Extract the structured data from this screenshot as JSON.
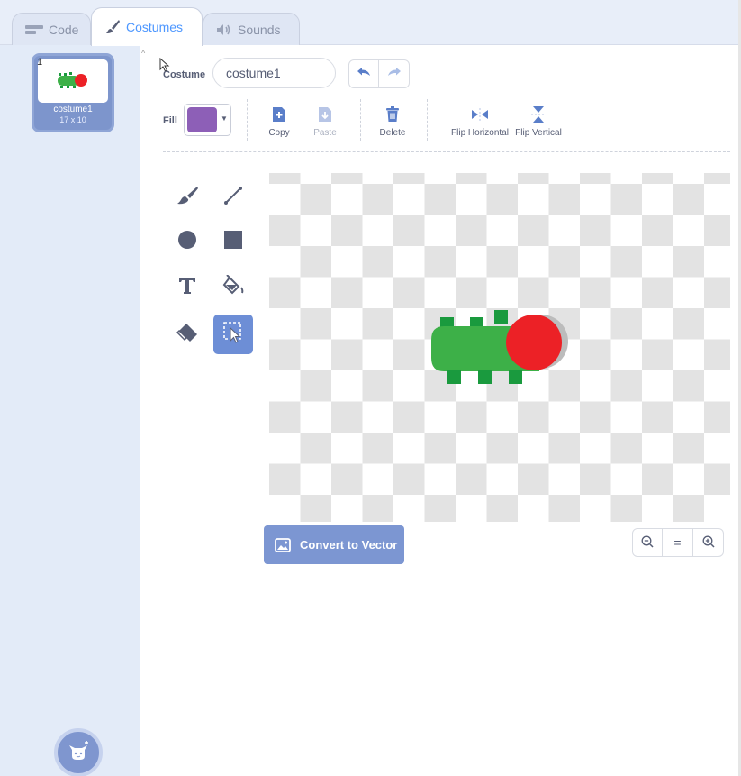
{
  "tabs": {
    "code": "Code",
    "costumes": "Costumes",
    "sounds": "Sounds"
  },
  "costume_list": {
    "items": [
      {
        "number": "1",
        "name": "costume1",
        "size": "17 x 10"
      }
    ]
  },
  "editor": {
    "costume_label": "Costume",
    "costume_name": "costume1",
    "fill_label": "Fill",
    "fill_color": "#8d5fb7",
    "actions": {
      "copy": "Copy",
      "paste": "Paste",
      "delete": "Delete",
      "flip_horizontal": "Flip Horizontal",
      "flip_vertical": "Flip Vertical"
    },
    "convert_button": "Convert to Vector",
    "zoom": {
      "reset": "="
    }
  },
  "colors": {
    "accent": "#4d97ff",
    "tool_active": "#6d8ed6",
    "button_blue": "#7c96d2",
    "sprite_green": "#3db048",
    "sprite_dark_green": "#1a9a3e",
    "sprite_red": "#ec2126"
  },
  "icons": {
    "code_tab": "code-blocks-icon",
    "costumes_tab": "paintbrush-icon",
    "sounds_tab": "speaker-icon",
    "tools": [
      "brush-icon",
      "line-icon",
      "circle-icon",
      "rectangle-icon",
      "text-icon",
      "fill-bucket-icon",
      "eraser-icon",
      "select-icon"
    ]
  }
}
